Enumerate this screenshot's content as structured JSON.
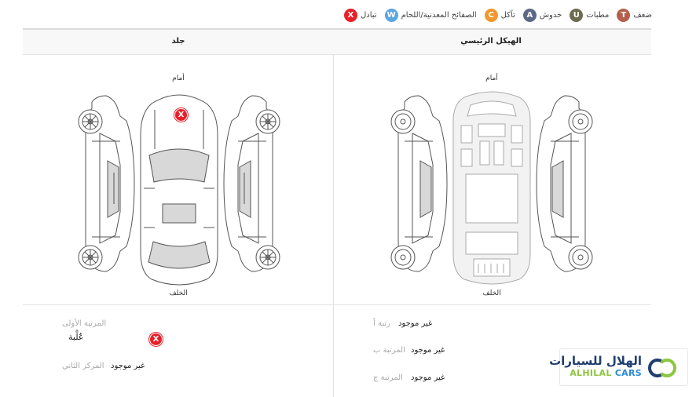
{
  "legend": [
    {
      "code": "T",
      "label": "ضعف",
      "color": "#b45f4c"
    },
    {
      "code": "U",
      "label": "مطبات",
      "color": "#6d6b50"
    },
    {
      "code": "A",
      "label": "خدوش",
      "color": "#5c6a87"
    },
    {
      "code": "C",
      "label": "تآكل",
      "color": "#f0972f"
    },
    {
      "code": "W",
      "label": "الصفائح المعدنية/اللحام",
      "color": "#5aa7e3"
    },
    {
      "code": "X",
      "label": "تبادل",
      "color": "#e8202a"
    }
  ],
  "columns": {
    "right_title": "الهيكل الرئيسي",
    "left_title": "جلد"
  },
  "diagram": {
    "front_label": "أمام",
    "rear_label": "الخلف",
    "left_front_label": "أمام",
    "left_rear_label": "الخلف",
    "damage_mark": "X"
  },
  "ranks_right": [
    {
      "label": "رتبة أ",
      "value": "غير موجود"
    },
    {
      "label": "المرتبة ب",
      "value": "غير موجود"
    },
    {
      "label": "المرتبة ج",
      "value": "غير موجود"
    }
  ],
  "ranks_left": {
    "first_label": "المرتبة الأولى",
    "first_value": "عُلْبة",
    "first_mark": "X",
    "second_label": "المركز الثاني",
    "second_value": "غير موجود"
  },
  "logo": {
    "arabic": "الهلال للسيارات",
    "english_1": "ALHILAL",
    "english_2": "CARS"
  }
}
